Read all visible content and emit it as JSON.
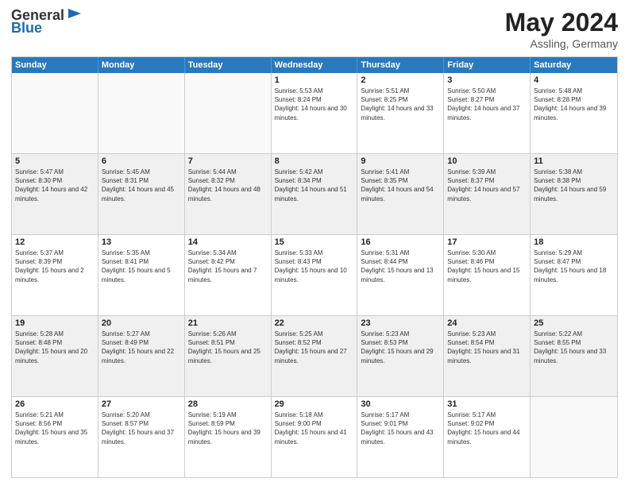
{
  "header": {
    "logo_general": "General",
    "logo_blue": "Blue",
    "month_title": "May 2024",
    "location": "Assling, Germany"
  },
  "days_of_week": [
    "Sunday",
    "Monday",
    "Tuesday",
    "Wednesday",
    "Thursday",
    "Friday",
    "Saturday"
  ],
  "weeks": [
    [
      {
        "day": "",
        "sunrise": "",
        "sunset": "",
        "daylight": "",
        "empty": true
      },
      {
        "day": "",
        "sunrise": "",
        "sunset": "",
        "daylight": "",
        "empty": true
      },
      {
        "day": "",
        "sunrise": "",
        "sunset": "",
        "daylight": "",
        "empty": true
      },
      {
        "day": "1",
        "sunrise": "Sunrise: 5:53 AM",
        "sunset": "Sunset: 8:24 PM",
        "daylight": "Daylight: 14 hours and 30 minutes."
      },
      {
        "day": "2",
        "sunrise": "Sunrise: 5:51 AM",
        "sunset": "Sunset: 8:25 PM",
        "daylight": "Daylight: 14 hours and 33 minutes."
      },
      {
        "day": "3",
        "sunrise": "Sunrise: 5:50 AM",
        "sunset": "Sunset: 8:27 PM",
        "daylight": "Daylight: 14 hours and 37 minutes."
      },
      {
        "day": "4",
        "sunrise": "Sunrise: 5:48 AM",
        "sunset": "Sunset: 8:28 PM",
        "daylight": "Daylight: 14 hours and 39 minutes."
      }
    ],
    [
      {
        "day": "5",
        "sunrise": "Sunrise: 5:47 AM",
        "sunset": "Sunset: 8:30 PM",
        "daylight": "Daylight: 14 hours and 42 minutes."
      },
      {
        "day": "6",
        "sunrise": "Sunrise: 5:45 AM",
        "sunset": "Sunset: 8:31 PM",
        "daylight": "Daylight: 14 hours and 45 minutes."
      },
      {
        "day": "7",
        "sunrise": "Sunrise: 5:44 AM",
        "sunset": "Sunset: 8:32 PM",
        "daylight": "Daylight: 14 hours and 48 minutes."
      },
      {
        "day": "8",
        "sunrise": "Sunrise: 5:42 AM",
        "sunset": "Sunset: 8:34 PM",
        "daylight": "Daylight: 14 hours and 51 minutes."
      },
      {
        "day": "9",
        "sunrise": "Sunrise: 5:41 AM",
        "sunset": "Sunset: 8:35 PM",
        "daylight": "Daylight: 14 hours and 54 minutes."
      },
      {
        "day": "10",
        "sunrise": "Sunrise: 5:39 AM",
        "sunset": "Sunset: 8:37 PM",
        "daylight": "Daylight: 14 hours and 57 minutes."
      },
      {
        "day": "11",
        "sunrise": "Sunrise: 5:38 AM",
        "sunset": "Sunset: 8:38 PM",
        "daylight": "Daylight: 14 hours and 59 minutes."
      }
    ],
    [
      {
        "day": "12",
        "sunrise": "Sunrise: 5:37 AM",
        "sunset": "Sunset: 8:39 PM",
        "daylight": "Daylight: 15 hours and 2 minutes."
      },
      {
        "day": "13",
        "sunrise": "Sunrise: 5:35 AM",
        "sunset": "Sunset: 8:41 PM",
        "daylight": "Daylight: 15 hours and 5 minutes."
      },
      {
        "day": "14",
        "sunrise": "Sunrise: 5:34 AM",
        "sunset": "Sunset: 8:42 PM",
        "daylight": "Daylight: 15 hours and 7 minutes."
      },
      {
        "day": "15",
        "sunrise": "Sunrise: 5:33 AM",
        "sunset": "Sunset: 8:43 PM",
        "daylight": "Daylight: 15 hours and 10 minutes."
      },
      {
        "day": "16",
        "sunrise": "Sunrise: 5:31 AM",
        "sunset": "Sunset: 8:44 PM",
        "daylight": "Daylight: 15 hours and 13 minutes."
      },
      {
        "day": "17",
        "sunrise": "Sunrise: 5:30 AM",
        "sunset": "Sunset: 8:46 PM",
        "daylight": "Daylight: 15 hours and 15 minutes."
      },
      {
        "day": "18",
        "sunrise": "Sunrise: 5:29 AM",
        "sunset": "Sunset: 8:47 PM",
        "daylight": "Daylight: 15 hours and 18 minutes."
      }
    ],
    [
      {
        "day": "19",
        "sunrise": "Sunrise: 5:28 AM",
        "sunset": "Sunset: 8:48 PM",
        "daylight": "Daylight: 15 hours and 20 minutes."
      },
      {
        "day": "20",
        "sunrise": "Sunrise: 5:27 AM",
        "sunset": "Sunset: 8:49 PM",
        "daylight": "Daylight: 15 hours and 22 minutes."
      },
      {
        "day": "21",
        "sunrise": "Sunrise: 5:26 AM",
        "sunset": "Sunset: 8:51 PM",
        "daylight": "Daylight: 15 hours and 25 minutes."
      },
      {
        "day": "22",
        "sunrise": "Sunrise: 5:25 AM",
        "sunset": "Sunset: 8:52 PM",
        "daylight": "Daylight: 15 hours and 27 minutes."
      },
      {
        "day": "23",
        "sunrise": "Sunrise: 5:23 AM",
        "sunset": "Sunset: 8:53 PM",
        "daylight": "Daylight: 15 hours and 29 minutes."
      },
      {
        "day": "24",
        "sunrise": "Sunrise: 5:23 AM",
        "sunset": "Sunset: 8:54 PM",
        "daylight": "Daylight: 15 hours and 31 minutes."
      },
      {
        "day": "25",
        "sunrise": "Sunrise: 5:22 AM",
        "sunset": "Sunset: 8:55 PM",
        "daylight": "Daylight: 15 hours and 33 minutes."
      }
    ],
    [
      {
        "day": "26",
        "sunrise": "Sunrise: 5:21 AM",
        "sunset": "Sunset: 8:56 PM",
        "daylight": "Daylight: 15 hours and 35 minutes."
      },
      {
        "day": "27",
        "sunrise": "Sunrise: 5:20 AM",
        "sunset": "Sunset: 8:57 PM",
        "daylight": "Daylight: 15 hours and 37 minutes."
      },
      {
        "day": "28",
        "sunrise": "Sunrise: 5:19 AM",
        "sunset": "Sunset: 8:59 PM",
        "daylight": "Daylight: 15 hours and 39 minutes."
      },
      {
        "day": "29",
        "sunrise": "Sunrise: 5:18 AM",
        "sunset": "Sunset: 9:00 PM",
        "daylight": "Daylight: 15 hours and 41 minutes."
      },
      {
        "day": "30",
        "sunrise": "Sunrise: 5:17 AM",
        "sunset": "Sunset: 9:01 PM",
        "daylight": "Daylight: 15 hours and 43 minutes."
      },
      {
        "day": "31",
        "sunrise": "Sunrise: 5:17 AM",
        "sunset": "Sunset: 9:02 PM",
        "daylight": "Daylight: 15 hours and 44 minutes."
      },
      {
        "day": "",
        "sunrise": "",
        "sunset": "",
        "daylight": "",
        "empty": true
      }
    ]
  ]
}
